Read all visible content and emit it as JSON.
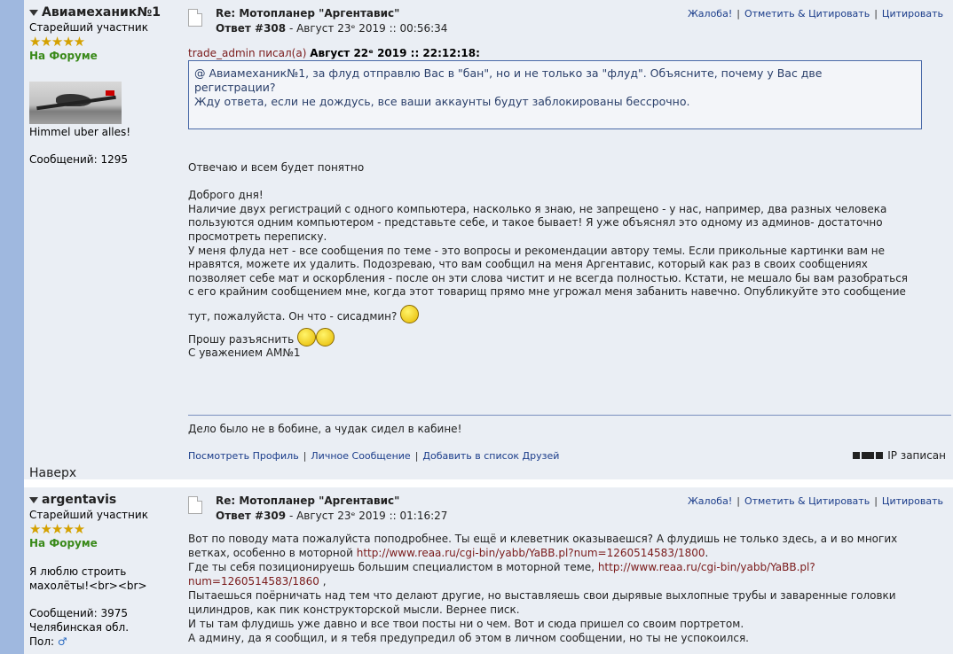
{
  "post1": {
    "author": {
      "name": "Авиамеханик№1",
      "rank": "Старейший участник",
      "stars": "★★★★★",
      "status": "На Форуме",
      "personal_text": "Himmel uber alles!",
      "posts": "Сообщений: 1295"
    },
    "subject": "Re: Мотопланер \"Аргентавис\"",
    "post_number": "Ответ #308",
    "date": "- Август 23ᵉ 2019 :: 00:56:34",
    "actions": [
      "Жалоба!",
      "Отметить & Цитировать",
      "Цитировать"
    ],
    "quote_header_who": "trade_admin писал(а)",
    "quote_header_date": "Август 22ᵉ 2019 :: 22:12:18:",
    "quote_lines": [
      "@ Авиамеханик№1, за флуд отправлю Вас в \"бан\", но и не только за \"флуд\". Объясните, почему у Вас две",
      "регистрации?",
      "Жду ответа, если не дождусь, все ваши аккаунты будут заблокированы бессрочно."
    ],
    "body_lines": [
      "Отвечаю и всем будет понятно",
      "",
      "Доброго дня!",
      "Наличие двух регистраций с одного компьютера, насколько я знаю, не запрещено - у нас, например, два разных человека",
      "пользуются одним компьютером - представьте себе, и такое бывает! Я уже объяснял это одному из админов- достаточно",
      "просмотреть переписку.",
      "У меня флуда нет - все сообщения по теме - это вопросы и рекомендации автору темы. Если прикольные картинки вам не",
      "нравятся, можете их удалить. Подозреваю, что вам сообщил на меня Аргентавис, который как раз в своих сообщениях",
      "позволяет себе мат и оскорбления - после он эти слова чистит и не всегда полностью. Кстати, не мешало бы вам разобраться",
      "с его крайним сообщением мне, когда этот товарищ прямо мне угрожал меня забанить навечно.  Опубликуйте это сообщение"
    ],
    "body_tail1": "тут, пожалуйста. Он что - сисадмин?",
    "body_tail2": "Прошу разъяснить",
    "body_tail3": "С уважением АМ№1",
    "signature": "Дело было не в бобине, а чудак сидел в кабине!",
    "profile_links": [
      "Посмотреть Профиль",
      "Личное Сообщение",
      "Добавить в список Друзей"
    ],
    "ip_label": "IP записан",
    "back_to_top": "Наверх"
  },
  "post2": {
    "author": {
      "name": "argentavis",
      "rank": "Старейший участник",
      "stars": "★★★★★",
      "status": "На Форуме",
      "personal_text_1": "Я люблю строить",
      "personal_text_2": "махолёты!<br><br>",
      "posts": "Сообщений: 3975",
      "location": "Челябинская обл.",
      "gender_label": "Пол:"
    },
    "subject": "Re: Мотопланер \"Аргентавис\"",
    "post_number": "Ответ #309",
    "date": "- Август 23ᵉ 2019 :: 01:16:27",
    "actions": [
      "Жалоба!",
      "Отметить & Цитировать",
      "Цитировать"
    ],
    "line1": "Вот по поводу мата пожалуйста поподробнее. Ты ещё и клеветник оказываешся? А флудишь  не только здесь, а и во многих",
    "line2a": "ветках, особенно в моторной ",
    "line2link": "http://www.reaa.ru/cgi-bin/yabb/YaBB.pl?num=1260514583/1800",
    "line2b": ".",
    "line3a": "Где ты себя позиционируешь большим специалистом в моторной теме, ",
    "line3link": "http://www.reaa.ru/cgi-bin/yabb/YaBB.pl?",
    "line4link": "num=1260514583/1860",
    "line4b": " ,",
    "line5": "Пытаешься поёрничать над тем что делают другие, но выставляешь свои дырявые выхлопные трубы и заваренные головки",
    "line6": "цилиндров, как пик конструкторской мысли. Вернее писк.",
    "line7": "И  ты там флудишь уже давно и все твои посты ни о чем. Вот и сюда пришел со своим портретом.",
    "line8": "А админу, да я сообщил, и я тебя предупредил об этом в личном сообщении, но ты не успокоился."
  }
}
